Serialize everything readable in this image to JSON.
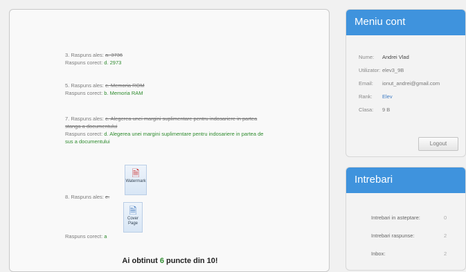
{
  "answers": [
    {
      "chosen_label": "3. Raspuns ales:",
      "chosen": "a. 3736",
      "correct_label": "Raspuns corect:",
      "correct": "d. 2973"
    },
    {
      "chosen_label": "5. Raspuns ales:",
      "chosen": "c. Memoria ROM",
      "correct_label": "Raspuns corect:",
      "correct": "b. Memoria RAM"
    },
    {
      "chosen_label": "7. Raspuns ales:",
      "chosen": "c. Alegerea unei margini suplimentare pentru indosariere in partea stanga a documentului",
      "correct_label": "Raspuns corect:",
      "correct": "d. Alegerea unei margini suplimentare pentru indosariere in partea de sus a documentului"
    }
  ],
  "q8": {
    "chosen_label": "8. Raspuns ales:",
    "chosen_letter": "e.",
    "correct_label": "Raspuns corect:",
    "correct_letter": "a",
    "icon_watermark": "Watermark",
    "icon_cover": "Cover Page"
  },
  "score": {
    "prefix": "Ai obtinut",
    "value": "6",
    "suffix": "puncte din 10!"
  },
  "account": {
    "title": "Meniu cont",
    "rows": [
      {
        "k": "Nume:",
        "v": "Andrei Vlad"
      },
      {
        "k": "Utilizator:",
        "v": "elev3_9B"
      },
      {
        "k": "Email:",
        "v": "ionut_andrei@gmail.com"
      },
      {
        "k": "Rank:",
        "v": "Elev"
      },
      {
        "k": "Clasa:",
        "v": "9 B"
      }
    ],
    "logout": "Logout"
  },
  "questions": {
    "title": "Intrebari",
    "rows": [
      {
        "k": "Intrebari in asteptare:",
        "v": "0"
      },
      {
        "k": "Intrebari raspunse:",
        "v": "2"
      },
      {
        "k": "Inbox:",
        "v": "2"
      }
    ]
  },
  "icons": {
    "watermark": "watermark-icon",
    "cover": "cover-page-icon"
  }
}
